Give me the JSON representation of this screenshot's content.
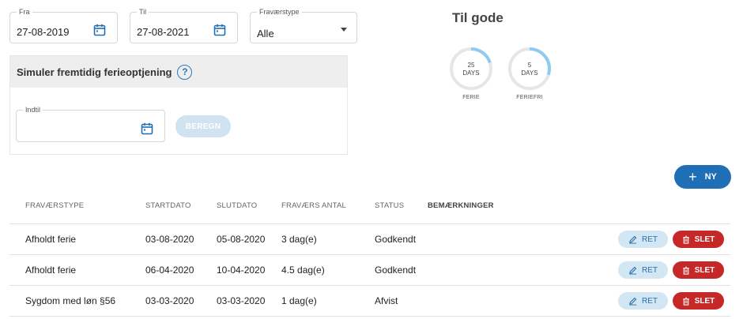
{
  "filters": {
    "fra": {
      "label": "Fra",
      "value": "27-08-2019"
    },
    "til": {
      "label": "Til",
      "value": "27-08-2021"
    },
    "fravaerstype": {
      "label": "Fraværstype",
      "value": "Alle"
    }
  },
  "simulate": {
    "title": "Simuler fremtidig ferieoptjening",
    "help": "?",
    "indtil_label": "Indtil",
    "beregn_label": "BEREGN"
  },
  "til_gode": {
    "title": "Til gode",
    "gauges": [
      {
        "value": "25",
        "unit": "DAYS",
        "label": "FERIE",
        "fraction": 0.2
      },
      {
        "value": "5",
        "unit": "DAYS",
        "label": "FERIEFRI",
        "fraction": 0.3
      }
    ]
  },
  "ny_label": "NY",
  "table": {
    "headers": [
      "FRAVÆRSTYPE",
      "STARTDATO",
      "SLUTDATO",
      "FRAVÆRS ANTAL",
      "STATUS",
      "BEMÆRKNINGER"
    ],
    "rows": [
      {
        "type": "Afholdt ferie",
        "start": "03-08-2020",
        "slut": "05-08-2020",
        "antal": "3 dag(e)",
        "status": "Godkendt"
      },
      {
        "type": "Afholdt ferie",
        "start": "06-04-2020",
        "slut": "10-04-2020",
        "antal": "4.5 dag(e)",
        "status": "Godkendt"
      },
      {
        "type": "Sygdom med løn §56",
        "start": "03-03-2020",
        "slut": "03-03-2020",
        "antal": "1 dag(e)",
        "status": "Afvist"
      }
    ],
    "ret_label": "RET",
    "slet_label": "SLET"
  },
  "colors": {
    "primary": "#1e6fb5",
    "danger": "#c62828",
    "gauge_track": "#e6e6e6",
    "gauge_fill": "#8fcbf0"
  },
  "icons": {
    "calendar": "calendar-icon",
    "caret": "chevron-down-icon",
    "plus": "plus-icon",
    "edit": "pencil-icon",
    "delete": "trash-icon"
  }
}
